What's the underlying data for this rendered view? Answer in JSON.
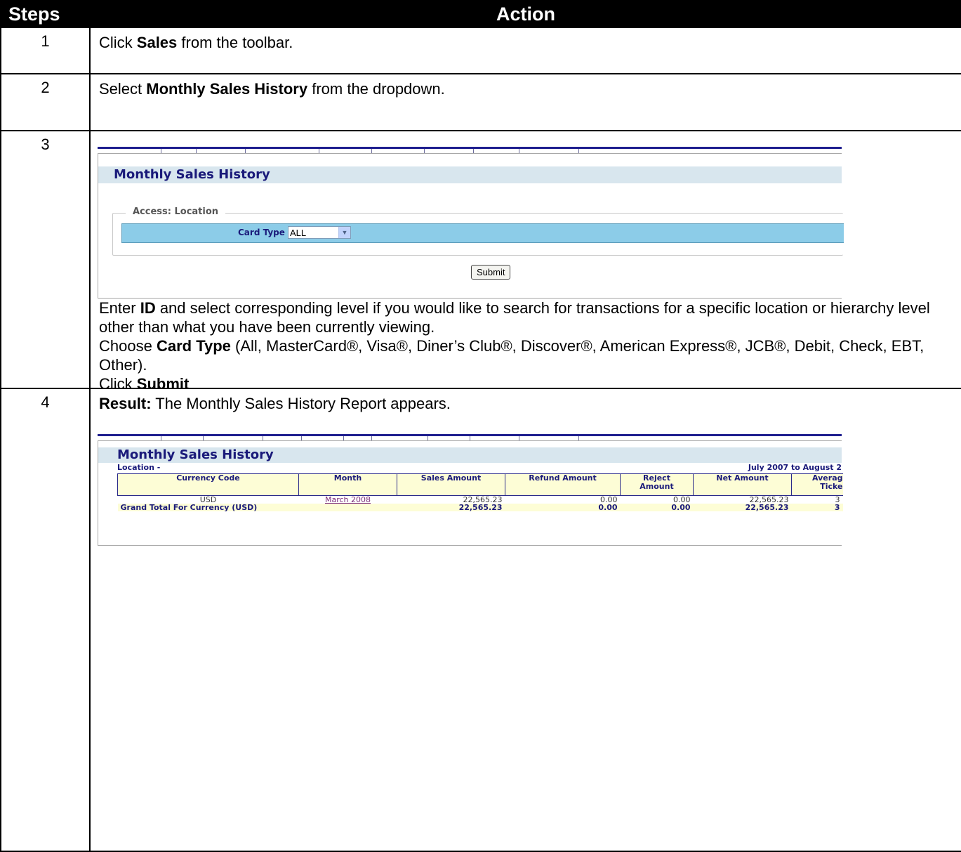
{
  "header": {
    "steps": "Steps",
    "action": "Action"
  },
  "steps": [
    {
      "num": "1",
      "pre": "Click ",
      "bold": "Sales",
      "post": " from the toolbar."
    },
    {
      "num": "2",
      "pre": "Select ",
      "bold": "Monthly Sales History",
      "post": " from the dropdown."
    },
    {
      "num": "3",
      "line1_pre": "Enter ",
      "line1_bold": "ID",
      "line1_post": " and select corresponding level if you would like to search for transactions for a specific location or hierarchy level other than what you have been currently viewing.",
      "line2_pre": "Choose ",
      "line2_bold": "Card Type",
      "line2_post": " (All, MasterCard®, Visa®, Diner’s Club®, Discover®, American Express®, JCB®, Debit, Check, EBT, Other).",
      "line3_pre": "Click ",
      "line3_bold": "Submit"
    },
    {
      "num": "4",
      "bold": "Result:",
      "post": " The Monthly Sales History Report appears."
    }
  ],
  "search_form": {
    "title": "Monthly Sales History",
    "legend": "Access: Location",
    "card_type_label": "Card Type",
    "card_type_value": "ALL",
    "submit_label": "Submit"
  },
  "report": {
    "title": "Monthly Sales History",
    "location": "Location -",
    "date_range": "July 2007 to August 2",
    "columns": [
      "Currency Code",
      "Month",
      "Sales Amount",
      "Refund Amount",
      "Reject Amount",
      "Net Amount",
      "Average Ticket"
    ],
    "column_display": [
      "Currency Code",
      "Month",
      "Sales Amount",
      "Refund Amount",
      "Reject\nAmount",
      "Net Amount",
      "Averag\nTicke"
    ],
    "row": {
      "currency": "USD",
      "month": "March 2008",
      "sales": "22,565.23",
      "refund": "0.00",
      "reject": "0.00",
      "net": "22,565.23",
      "avg": "3"
    },
    "total": {
      "label": "Grand Total For Currency (USD)",
      "sales": "22,565.23",
      "refund": "0.00",
      "reject": "0.00",
      "net": "22,565.23",
      "avg": "3"
    }
  }
}
